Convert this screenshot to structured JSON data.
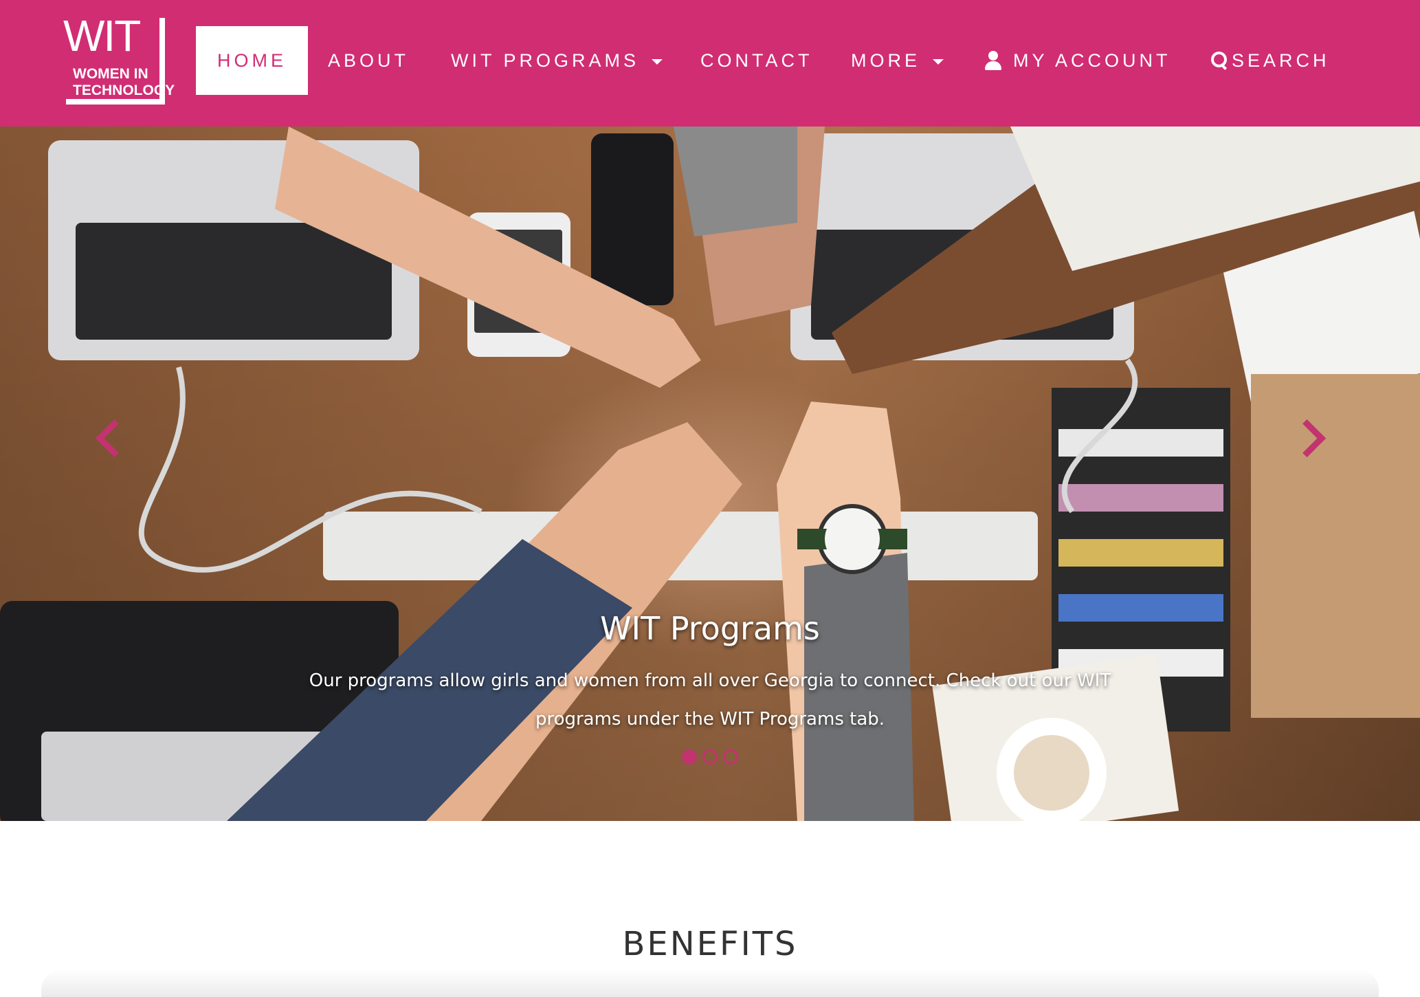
{
  "brand": {
    "logo_big": "WIT",
    "logo_line1": "WOMEN IN",
    "logo_line2": "TECHNOLOGY",
    "accent_color": "#d12d73"
  },
  "nav": {
    "home": "HOME",
    "about": "ABOUT",
    "programs": "WIT PROGRAMS",
    "contact": "CONTACT",
    "more": "MORE",
    "account": "MY ACCOUNT",
    "search": "SEARCH"
  },
  "hero": {
    "title": "WIT Programs",
    "text": "Our programs allow girls and women from all over Georgia to connect. Check out our WIT programs under the WIT Programs tab.",
    "image_alt": "hands fist bump over laptops",
    "active_slide": 1,
    "slide_count": 3
  },
  "benefits": {
    "title": "BENEFITS"
  }
}
